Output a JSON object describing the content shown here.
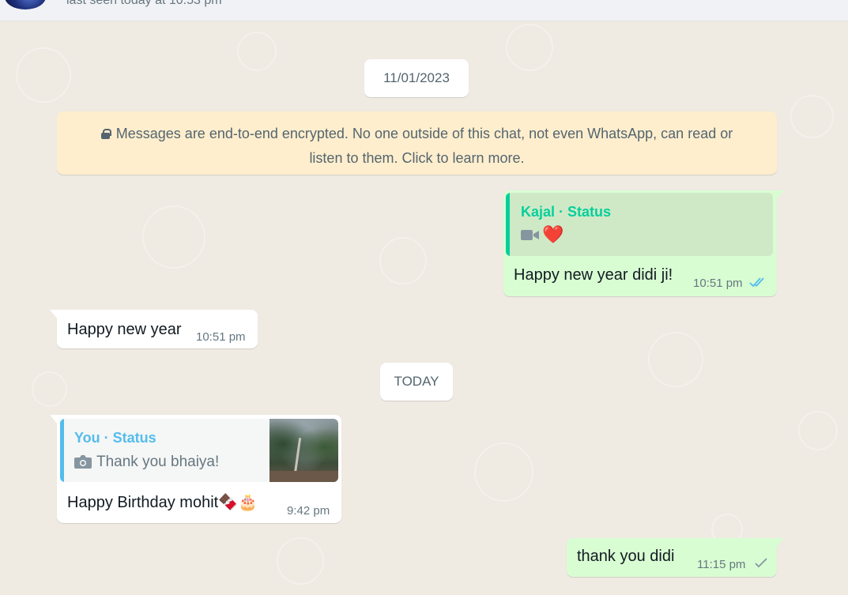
{
  "header": {
    "last_seen": "last seen today at 10:53 pm"
  },
  "dates": {
    "first": "11/01/2023",
    "second": "TODAY"
  },
  "encryption_notice": "Messages are end-to-end encrypted. No one outside of this chat, not even WhatsApp, can read or listen to them. Click to learn more.",
  "messages": [
    {
      "direction": "outgoing",
      "quote_title": "Kajal · Status",
      "quote_emoji": "❤️",
      "text": "Happy new year didi ji!",
      "time": "10:51 pm",
      "status": "read"
    },
    {
      "direction": "incoming",
      "text": "Happy new year",
      "time": "10:51 pm"
    },
    {
      "direction": "incoming",
      "quote_title": "You · Status",
      "quote_text": "Thank you bhaiya!",
      "text": "Happy Birthday mohit🍫🎂",
      "time": "9:42 pm"
    },
    {
      "direction": "outgoing",
      "text": "thank you didi",
      "time": "11:15 pm",
      "status": "sent"
    }
  ],
  "colors": {
    "chat_bg": "#efeae2",
    "outgoing_bubble": "#d9fdd3",
    "incoming_bubble": "#ffffff",
    "encrypt_bg": "#ffeecd",
    "kajal_quote_accent": "#06cf9c",
    "you_quote_accent": "#53bdeb",
    "read_tick": "#53bdeb"
  },
  "icons": {
    "lock": "lock-icon",
    "video": "video-camera-icon",
    "camera": "camera-icon",
    "double_tick": "double-check-icon",
    "single_tick": "single-check-icon"
  }
}
